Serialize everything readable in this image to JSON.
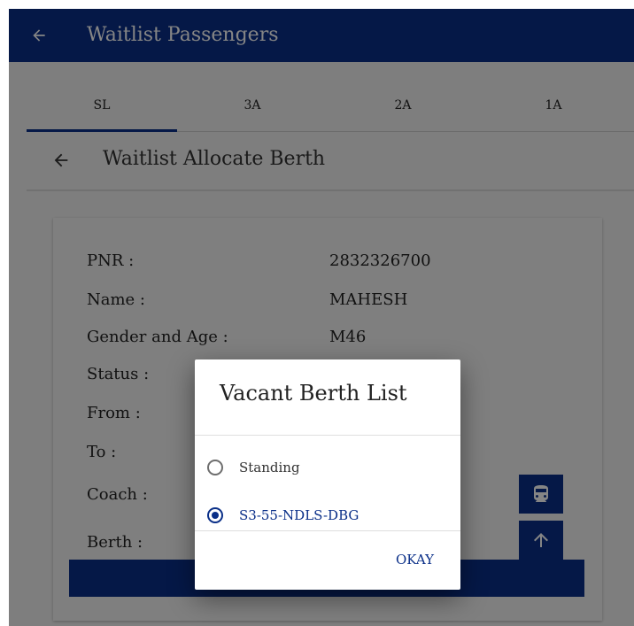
{
  "appbar": {
    "title": "Waitlist Passengers",
    "back_icon": "arrow-left-icon"
  },
  "tabs": [
    {
      "label": "SL",
      "selected": true
    },
    {
      "label": "3A",
      "selected": false
    },
    {
      "label": "2A",
      "selected": false
    },
    {
      "label": "1A",
      "selected": false
    }
  ],
  "subheader": {
    "title": "Waitlist Allocate Berth",
    "back_icon": "arrow-left-icon"
  },
  "passenger": {
    "pnr_label": "PNR :",
    "pnr_value": "2832326700",
    "name_label": "Name :",
    "name_value": "MAHESH",
    "gender_age_label": "Gender and Age :",
    "gender_age_value": "M46",
    "status_label": "Status :",
    "from_label": "From :",
    "to_label": "To :",
    "coach_label": "Coach :",
    "berth_label": "Berth :"
  },
  "buttons": {
    "coach_icon": "train-icon",
    "berth_icon": "arrow-up-icon"
  },
  "dialog": {
    "title": "Vacant Berth List",
    "options": [
      {
        "label": "Standing",
        "selected": false
      },
      {
        "label": "S3-55-NDLS-DBG",
        "selected": true
      }
    ],
    "okay_label": "OKAY"
  },
  "colors": {
    "primary": "#0a2f88",
    "background": "#f2f2f2",
    "dialog_bg": "#ffffff"
  }
}
